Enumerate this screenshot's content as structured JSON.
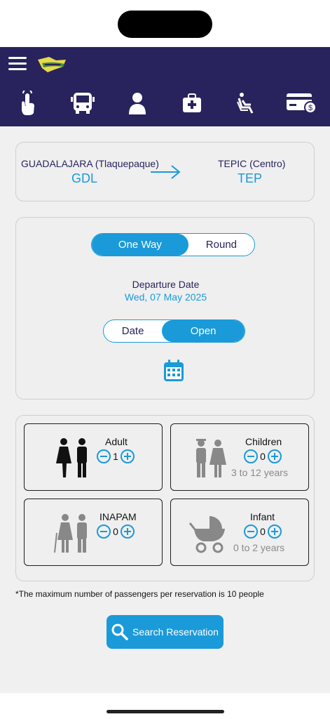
{
  "colors": {
    "header_bg": "#28235d",
    "accent": "#1a9ad9",
    "text_dark": "#28235d"
  },
  "steps": [
    {
      "icon": "touch-hand-icon"
    },
    {
      "icon": "bus-icon"
    },
    {
      "icon": "passenger-icon"
    },
    {
      "icon": "luggage-icon"
    },
    {
      "icon": "seat-icon"
    },
    {
      "icon": "payment-card-icon"
    }
  ],
  "route": {
    "origin_name": "GUADALAJARA (Tlaquepaque)",
    "origin_code": "GDL",
    "destination_name": "TEPIC (Centro)",
    "destination_code": "TEP"
  },
  "trip_type": {
    "one_way": "One Way",
    "round": "Round",
    "selected": "One Way"
  },
  "departure": {
    "label": "Departure Date",
    "date": "Wed, 07 May 2025"
  },
  "date_mode": {
    "date": "Date",
    "open": "Open",
    "selected": "Open"
  },
  "passengers": {
    "adult": {
      "label": "Adult",
      "count": "1"
    },
    "children": {
      "label": "Children",
      "count": "0",
      "range": "3 to 12 years"
    },
    "inapam": {
      "label": "INAPAM",
      "count": "0"
    },
    "infant": {
      "label": "Infant",
      "count": "0",
      "range": "0 to 2 years"
    }
  },
  "note": "*The maximum number of passengers per reservation is 10 people",
  "search_button": "Search Reservation"
}
